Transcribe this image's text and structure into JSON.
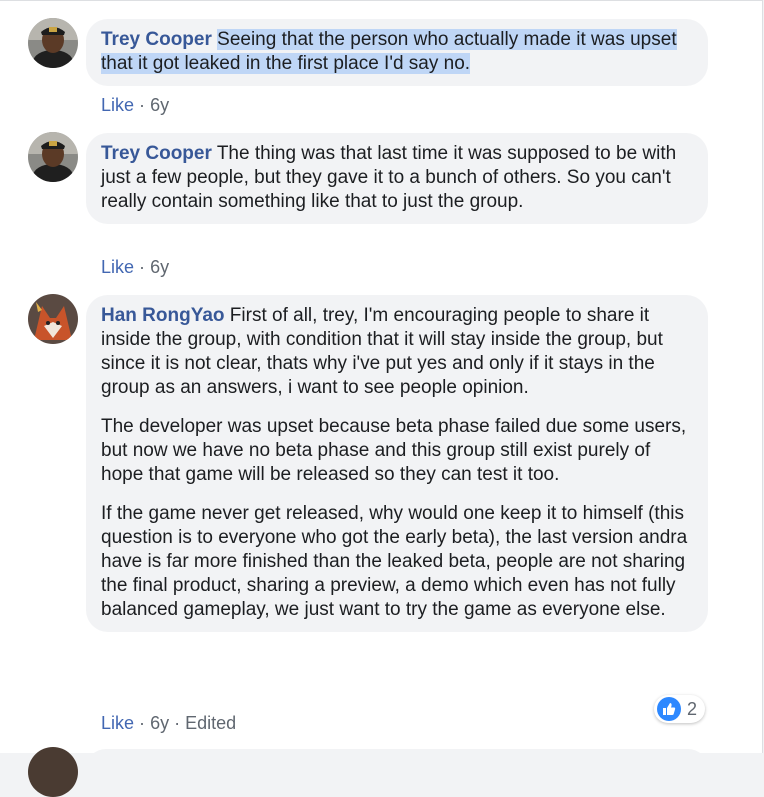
{
  "comments": [
    {
      "author": "Trey Cooper",
      "avatar_icon": "profile-photo-trey",
      "text_highlighted": "Seeing that the person who actually made it was upset that it got leaked in the first place I'd say no.",
      "like_label": "Like",
      "separator": "·",
      "time": "6y"
    },
    {
      "author": "Trey Cooper",
      "avatar_icon": "profile-photo-trey",
      "text": "The thing was that last time it was supposed to be with just a few people, but they gave it to a bunch of others. So you can't really contain something like that to just the group.",
      "like_label": "Like",
      "separator": "·",
      "time": "6y"
    },
    {
      "author": "Han RongYao",
      "avatar_icon": "profile-photo-fox",
      "paragraphs": [
        "First of all, trey, I'm encouraging people to share it inside the group, with condition that it will stay inside the group, but since it is not clear, thats why i've put yes and only if it stays in the group as an answers, i want to see people opinion.",
        "The developer was upset because beta phase failed due some users, but now we have no beta phase and this group still exist purely of hope that game will be released so they can test it too.",
        "If the game never get released, why would one keep it to himself (this question is to everyone who got the early beta), the last version andra have is far more finished than the leaked beta, people are not sharing the final product, sharing a preview, a demo which even has not fully balanced gameplay, we just want to try the game as everyone else."
      ],
      "like_label": "Like",
      "separator": "·",
      "time": "6y",
      "edited_label": "Edited",
      "reaction": {
        "icon": "thumbs-up-icon",
        "count": "2",
        "color": "#2d88ff"
      }
    }
  ],
  "colors": {
    "author": "#385898",
    "highlight": "#bfd6f6",
    "bubble": "#f2f3f5",
    "meta": "#606770",
    "like": "#4267b2"
  }
}
